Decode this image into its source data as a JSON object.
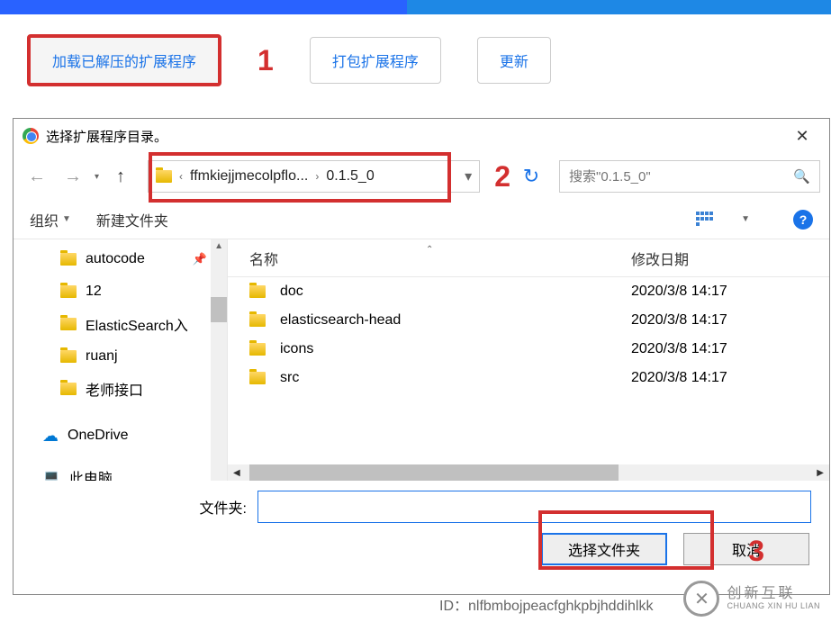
{
  "toolbar": {
    "load_unpacked": "加载已解压的扩展程序",
    "pack": "打包扩展程序",
    "update": "更新"
  },
  "annotations": {
    "step1": "1",
    "step2": "2",
    "step3": "3"
  },
  "dialog": {
    "title": "选择扩展程序目录。",
    "breadcrumb": {
      "seg1": "ffmkiejjmecolpflo...",
      "seg2": "0.1.5_0"
    },
    "search_placeholder": "搜索\"0.1.5_0\"",
    "options": {
      "organize": "组织",
      "new_folder": "新建文件夹"
    },
    "sidebar": {
      "items": [
        {
          "name": "autocode",
          "pinned": true
        },
        {
          "name": "12"
        },
        {
          "name": "ElasticSearch入"
        },
        {
          "name": "ruanj"
        },
        {
          "name": "老师接口"
        }
      ],
      "onedrive": "OneDrive",
      "this_pc": "此电脑"
    },
    "list": {
      "col_name": "名称",
      "col_date": "修改日期",
      "rows": [
        {
          "name": "doc",
          "date": "2020/3/8 14:17"
        },
        {
          "name": "elasticsearch-head",
          "date": "2020/3/8 14:17"
        },
        {
          "name": "icons",
          "date": "2020/3/8 14:17"
        },
        {
          "name": "src",
          "date": "2020/3/8 14:17"
        }
      ]
    },
    "folder_label": "文件夹:",
    "select_btn": "选择文件夹",
    "cancel_btn": "取消"
  },
  "bottom": {
    "id_label": "ID：nlfbmbojpeacfghkpbjhddihlkk"
  },
  "watermark": {
    "cn": "创新互联",
    "en": "CHUANG XIN HU LIAN"
  }
}
